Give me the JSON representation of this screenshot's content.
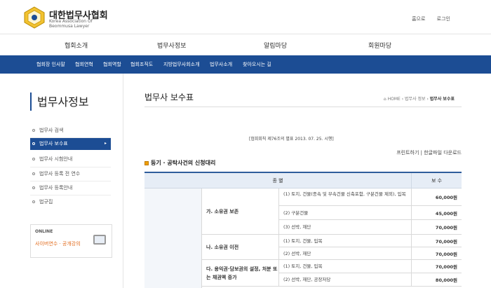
{
  "brand": {
    "name_ko": "대한법무사협회",
    "name_en": "Korea Association Of Beommusa Lawyer"
  },
  "top_links": [
    "홈으로",
    "로그인"
  ],
  "main_nav": [
    "협회소개",
    "법무사정보",
    "알림마당",
    "회원마당"
  ],
  "sub_nav": [
    "협회장 인사말",
    "협회연혁",
    "협회역할",
    "협회조직도",
    "지방법무사회소개",
    "법무사소개",
    "찾아오시는 길"
  ],
  "left_menu": {
    "title": "법무사정보",
    "items": [
      "법무사 검색",
      "법무사 보수표",
      "법무사 시험안내",
      "법무사 등록 전 연수",
      "법무사 등록안내",
      "법규집"
    ],
    "active_index": 1
  },
  "online_banner": {
    "label": "ONLINE",
    "text": "사이버연수 · 공개강의"
  },
  "page": {
    "title": "법무사 보수표",
    "breadcrumb": [
      "HOME",
      "법무사 정보",
      "법무사 보수표"
    ],
    "notice": "[협회회칙 제76조의 별표 2013. 07. 25. 시행]",
    "print_links": "프린트하기 | 한글파일 다운로드",
    "section_title": "등기 · 공탁사건의 신청대리"
  },
  "table": {
    "headers": [
      "종 별",
      "보 수"
    ],
    "groups": [
      {
        "label": "가. 소유권 보존",
        "rows": [
          {
            "desc": "(1) 토지, 건물(종속 및 부속건물 신축포함, 구분건물 제외), 입목",
            "amount": "60,000원"
          },
          {
            "desc": "(2) 구분건물",
            "amount": "45,000원"
          },
          {
            "desc": "(3) 선박, 재단",
            "amount": "70,000원"
          }
        ]
      },
      {
        "label": "나. 소유권 이전",
        "rows": [
          {
            "desc": "(1) 토지, 건물, 입목",
            "amount": "70,000원"
          },
          {
            "desc": "(2) 선박, 재단",
            "amount": "70,000원"
          }
        ]
      },
      {
        "label": "다. 용익권·담보권의 설정, 처분 또는 채권액 증가",
        "rows": [
          {
            "desc": "(1) 토지, 건물, 입목",
            "amount": "70,000원"
          },
          {
            "desc": "(2) 선박, 재단, 공장저당",
            "amount": "80,000원"
          }
        ]
      }
    ]
  },
  "colors": {
    "primary": "#1c4d94",
    "accent": "#f0a000",
    "link_orange": "#e26b1c"
  },
  "icons": {
    "logo": "association-emblem-icon",
    "home": "home-icon",
    "bullet": "circle-bullet-icon",
    "arrow": "chevron-right-icon",
    "monitor": "monitor-icon"
  }
}
